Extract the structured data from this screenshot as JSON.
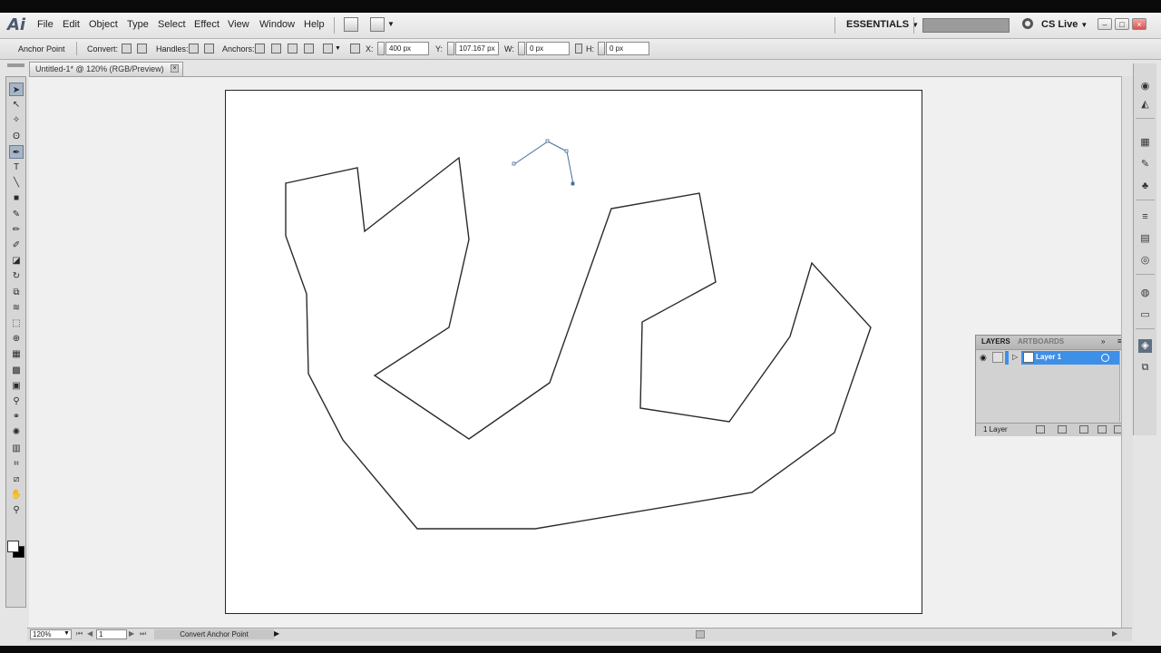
{
  "app": {
    "logo": "Ai"
  },
  "menu": {
    "items": [
      "File",
      "Edit",
      "Object",
      "Type",
      "Select",
      "Effect",
      "View",
      "Window",
      "Help"
    ],
    "workspace": "ESSENTIALS",
    "cs_live": "CS Live",
    "window_buttons": [
      "–",
      "□",
      "×"
    ]
  },
  "control": {
    "anchor_point": "Anchor Point",
    "convert": "Convert:",
    "handles": "Handles:",
    "anchors": "Anchors:",
    "x_label": "X:",
    "x_value": "400 px",
    "y_label": "Y:",
    "y_value": "107.167 px",
    "w_label": "W:",
    "w_value": "0 px",
    "h_label": "H:",
    "h_value": "0 px"
  },
  "document": {
    "tab_title": "Untitled-1* @ 120% (RGB/Preview)"
  },
  "tools": [
    {
      "name": "selection-tool",
      "glyph": "➤",
      "active": true
    },
    {
      "name": "direct-selection-tool",
      "glyph": "↖"
    },
    {
      "name": "magic-wand-tool",
      "glyph": "✧"
    },
    {
      "name": "lasso-tool",
      "glyph": "ʘ"
    },
    {
      "name": "pen-tool",
      "glyph": "✒",
      "active": true
    },
    {
      "name": "type-tool",
      "glyph": "T"
    },
    {
      "name": "line-tool",
      "glyph": "╲"
    },
    {
      "name": "rectangle-tool",
      "glyph": "■"
    },
    {
      "name": "paintbrush-tool",
      "glyph": "✎"
    },
    {
      "name": "pencil-tool",
      "glyph": "✏"
    },
    {
      "name": "blob-brush-tool",
      "glyph": "✐"
    },
    {
      "name": "eraser-tool",
      "glyph": "◪"
    },
    {
      "name": "rotate-tool",
      "glyph": "↻"
    },
    {
      "name": "scale-tool",
      "glyph": "⧉"
    },
    {
      "name": "warp-tool",
      "glyph": "≋"
    },
    {
      "name": "free-transform-tool",
      "glyph": "⬚"
    },
    {
      "name": "shape-builder-tool",
      "glyph": "⊕"
    },
    {
      "name": "perspective-grid-tool",
      "glyph": "▦"
    },
    {
      "name": "mesh-tool",
      "glyph": "▩"
    },
    {
      "name": "gradient-tool",
      "glyph": "▣"
    },
    {
      "name": "eyedropper-tool",
      "glyph": "⚲"
    },
    {
      "name": "blend-tool",
      "glyph": "⚭"
    },
    {
      "name": "symbol-sprayer-tool",
      "glyph": "✺"
    },
    {
      "name": "column-graph-tool",
      "glyph": "▥"
    },
    {
      "name": "artboard-tool",
      "glyph": "⌗"
    },
    {
      "name": "slice-tool",
      "glyph": "⧄"
    },
    {
      "name": "hand-tool",
      "glyph": "✋"
    },
    {
      "name": "zoom-tool",
      "glyph": "⚲"
    }
  ],
  "layers_panel": {
    "tabs": [
      "LAYERS",
      "ARTBOARDS"
    ],
    "layer_name": "Layer 1",
    "count": "1 Layer"
  },
  "status": {
    "zoom": "120%",
    "page": "1",
    "tool_name": "Convert Anchor Point"
  },
  "colors": {
    "selection_blue": "#3e8fe8",
    "path_stroke": "#2b2b2b",
    "open_path": "#4a6c9c"
  }
}
